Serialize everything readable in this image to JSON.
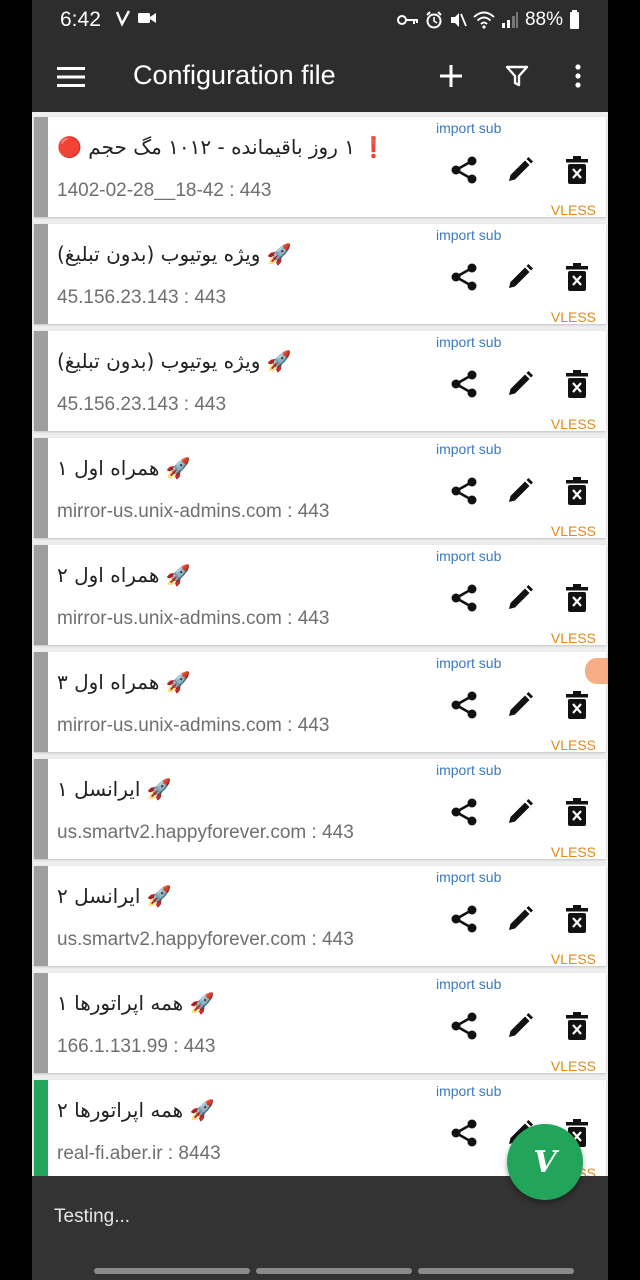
{
  "status_bar": {
    "time": "6:42",
    "battery": "88%"
  },
  "app_bar": {
    "title": "Configuration file"
  },
  "configs": [
    {
      "name": "❗ ۱ روز باقیمانده - ۱۰۱۲ مگ حجم 🔴",
      "address": "1402-02-28__18-42 : 443",
      "sub": "import sub",
      "type": "VLESS",
      "active": false
    },
    {
      "name": "🚀 ویژه یوتیوب (بدون تبلیغ)",
      "address": "45.156.23.143 : 443",
      "sub": "import sub",
      "type": "VLESS",
      "active": false
    },
    {
      "name": "🚀 ویژه یوتیوب (بدون تبلیغ)",
      "address": "45.156.23.143 : 443",
      "sub": "import sub",
      "type": "VLESS",
      "active": false
    },
    {
      "name": "🚀 همراه اول ۱",
      "address": "mirror-us.unix-admins.com : 443",
      "sub": "import sub",
      "type": "VLESS",
      "active": false
    },
    {
      "name": "🚀 همراه اول ۲",
      "address": "mirror-us.unix-admins.com : 443",
      "sub": "import sub",
      "type": "VLESS",
      "active": false
    },
    {
      "name": "🚀 همراه اول ۳",
      "address": "mirror-us.unix-admins.com : 443",
      "sub": "import sub",
      "type": "VLESS",
      "active": false
    },
    {
      "name": "🚀 ایرانسل ۱",
      "address": "us.smartv2.happyforever.com : 443",
      "sub": "import sub",
      "type": "VLESS",
      "active": false
    },
    {
      "name": "🚀 ایرانسل ۲",
      "address": "us.smartv2.happyforever.com : 443",
      "sub": "import sub",
      "type": "VLESS",
      "active": false
    },
    {
      "name": "🚀 همه اپراتورها ۱",
      "address": "166.1.131.99 : 443",
      "sub": "import sub",
      "type": "VLESS",
      "active": false
    },
    {
      "name": "🚀 همه اپراتورها ۲",
      "address": "real-fi.aber.ir : 8443",
      "sub": "import sub",
      "type": "VLESS",
      "active": true
    }
  ],
  "bottom": {
    "status": "Testing..."
  },
  "fab": {
    "label": "V"
  },
  "colors": {
    "bar": "#2d2d2d",
    "accent": "#22a55a",
    "sub": "#3a7abf",
    "type": "#e08a1a"
  }
}
